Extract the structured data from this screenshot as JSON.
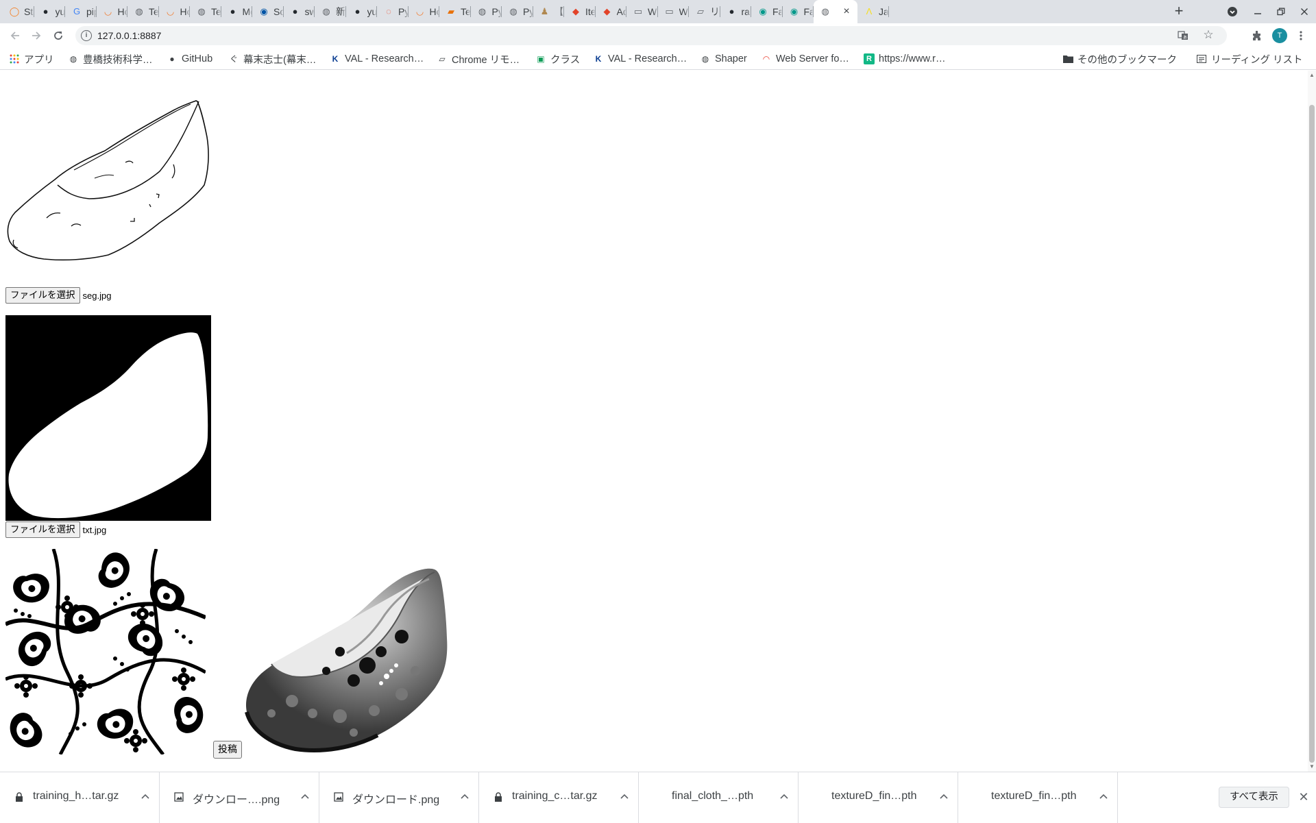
{
  "browser": {
    "tabs": [
      {
        "title": "Sta",
        "icon": "stackoverflow-icon",
        "glyph": "◯",
        "color": "#f48024"
      },
      {
        "title": "yuc",
        "icon": "github-icon",
        "glyph": "●",
        "color": "#24292e"
      },
      {
        "title": "pip",
        "icon": "google-icon",
        "glyph": "G",
        "color": "#4285f4"
      },
      {
        "title": "Ho",
        "icon": "jupyter-icon",
        "glyph": "◡",
        "color": "#f37726"
      },
      {
        "title": "Tes",
        "icon": "globe-icon",
        "glyph": "◍",
        "color": "#5f6368"
      },
      {
        "title": "Ho",
        "icon": "jupyter-icon",
        "glyph": "◡",
        "color": "#f37726"
      },
      {
        "title": "Tes",
        "icon": "globe-icon",
        "glyph": "◍",
        "color": "#5f6368"
      },
      {
        "title": "Mo",
        "icon": "github-icon",
        "glyph": "●",
        "color": "#24292e"
      },
      {
        "title": "Sci",
        "icon": "scipy-icon",
        "glyph": "◉",
        "color": "#0054a6"
      },
      {
        "title": "swi",
        "icon": "github-icon",
        "glyph": "●",
        "color": "#24292e"
      },
      {
        "title": "新!",
        "icon": "globe-icon",
        "glyph": "◍",
        "color": "#5f6368"
      },
      {
        "title": "yuc",
        "icon": "github-icon",
        "glyph": "●",
        "color": "#24292e"
      },
      {
        "title": "Pyt",
        "icon": "pytorch-icon",
        "glyph": "◌",
        "color": "#ee4c2c"
      },
      {
        "title": "Ho",
        "icon": "jupyter-icon",
        "glyph": "◡",
        "color": "#f37726"
      },
      {
        "title": "Tes",
        "icon": "book-icon",
        "glyph": "▰",
        "color": "#e8710a"
      },
      {
        "title": "Pyt",
        "icon": "globe-icon",
        "glyph": "◍",
        "color": "#5f6368"
      },
      {
        "title": "Pyt",
        "icon": "globe-icon",
        "glyph": "◍",
        "color": "#5f6368"
      },
      {
        "title": "【F",
        "icon": "mascot-icon",
        "glyph": "♟",
        "color": "#b08850"
      },
      {
        "title": "Iter",
        "icon": "gitlab-icon",
        "glyph": "◆",
        "color": "#e24329"
      },
      {
        "title": "Ad",
        "icon": "gitlab-icon",
        "glyph": "◆",
        "color": "#e24329"
      },
      {
        "title": "Wi",
        "icon": "monitor-icon",
        "glyph": "▭",
        "color": "#5f6368"
      },
      {
        "title": "Wi",
        "icon": "monitor-icon",
        "glyph": "▭",
        "color": "#5f6368"
      },
      {
        "title": "リモ",
        "icon": "remote-desktop-icon",
        "glyph": "▱",
        "color": "#5f6368"
      },
      {
        "title": "rak",
        "icon": "github-icon",
        "glyph": "●",
        "color": "#24292e"
      },
      {
        "title": "Fas",
        "icon": "fastapi-icon",
        "glyph": "◉",
        "color": "#05998b"
      },
      {
        "title": "Fas",
        "icon": "fastapi-icon",
        "glyph": "◉",
        "color": "#05998b"
      },
      {
        "title": "",
        "icon": "globe-icon",
        "glyph": "◍",
        "color": "#5f6368",
        "active": true
      },
      {
        "title": "Jav",
        "icon": "javascript-icon",
        "glyph": "Λ",
        "color": "#f7df1e"
      }
    ],
    "url": "127.0.0.1:8887",
    "avatar_letter": "T",
    "accent_color": "#1a8fa0"
  },
  "bookmarks": {
    "apps": "アプリ",
    "items": [
      "豊橋技術科学…",
      "GitHub",
      "幕末志士(幕末…",
      "VAL - Research…",
      "Chrome リモ…",
      "クラス",
      "VAL - Research…",
      "Shaper",
      "Web Server fo…",
      "https://www.r…"
    ],
    "other": "その他のブックマーク",
    "reading_list": "リーディング リスト"
  },
  "page": {
    "seg_file_button": "ファイルを選択",
    "seg_file_name": "seg.jpg",
    "txt_file_button": "ファイルを選択",
    "txt_file_name": "txt.jpg",
    "submit_label": "投稿"
  },
  "downloads": {
    "items": [
      {
        "name": "training_h…tar.gz",
        "icon": "archive-icon"
      },
      {
        "name": "ダウンロー….png",
        "icon": "image-file-icon"
      },
      {
        "name": "ダウンロード.png",
        "icon": "image-file-icon"
      },
      {
        "name": "training_c…tar.gz",
        "icon": "archive-icon"
      },
      {
        "name": "final_cloth_…pth",
        "icon": "file-icon"
      },
      {
        "name": "textureD_fin…pth",
        "icon": "file-icon"
      },
      {
        "name": "textureD_fin…pth",
        "icon": "file-icon"
      }
    ],
    "show_all": "すべて表示"
  }
}
